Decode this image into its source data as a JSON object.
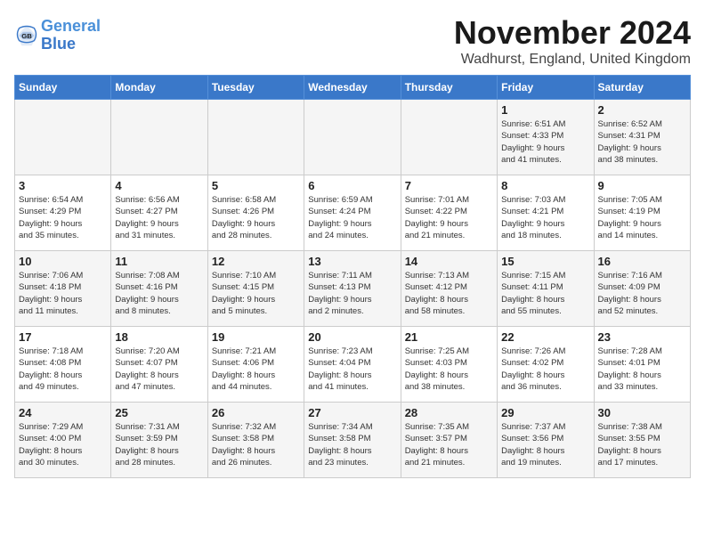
{
  "logo": {
    "text_general": "General",
    "text_blue": "Blue"
  },
  "header": {
    "title": "November 2024",
    "subtitle": "Wadhurst, England, United Kingdom"
  },
  "days_of_week": [
    "Sunday",
    "Monday",
    "Tuesday",
    "Wednesday",
    "Thursday",
    "Friday",
    "Saturday"
  ],
  "weeks": [
    [
      {
        "day": "",
        "info": ""
      },
      {
        "day": "",
        "info": ""
      },
      {
        "day": "",
        "info": ""
      },
      {
        "day": "",
        "info": ""
      },
      {
        "day": "",
        "info": ""
      },
      {
        "day": "1",
        "info": "Sunrise: 6:51 AM\nSunset: 4:33 PM\nDaylight: 9 hours\nand 41 minutes."
      },
      {
        "day": "2",
        "info": "Sunrise: 6:52 AM\nSunset: 4:31 PM\nDaylight: 9 hours\nand 38 minutes."
      }
    ],
    [
      {
        "day": "3",
        "info": "Sunrise: 6:54 AM\nSunset: 4:29 PM\nDaylight: 9 hours\nand 35 minutes."
      },
      {
        "day": "4",
        "info": "Sunrise: 6:56 AM\nSunset: 4:27 PM\nDaylight: 9 hours\nand 31 minutes."
      },
      {
        "day": "5",
        "info": "Sunrise: 6:58 AM\nSunset: 4:26 PM\nDaylight: 9 hours\nand 28 minutes."
      },
      {
        "day": "6",
        "info": "Sunrise: 6:59 AM\nSunset: 4:24 PM\nDaylight: 9 hours\nand 24 minutes."
      },
      {
        "day": "7",
        "info": "Sunrise: 7:01 AM\nSunset: 4:22 PM\nDaylight: 9 hours\nand 21 minutes."
      },
      {
        "day": "8",
        "info": "Sunrise: 7:03 AM\nSunset: 4:21 PM\nDaylight: 9 hours\nand 18 minutes."
      },
      {
        "day": "9",
        "info": "Sunrise: 7:05 AM\nSunset: 4:19 PM\nDaylight: 9 hours\nand 14 minutes."
      }
    ],
    [
      {
        "day": "10",
        "info": "Sunrise: 7:06 AM\nSunset: 4:18 PM\nDaylight: 9 hours\nand 11 minutes."
      },
      {
        "day": "11",
        "info": "Sunrise: 7:08 AM\nSunset: 4:16 PM\nDaylight: 9 hours\nand 8 minutes."
      },
      {
        "day": "12",
        "info": "Sunrise: 7:10 AM\nSunset: 4:15 PM\nDaylight: 9 hours\nand 5 minutes."
      },
      {
        "day": "13",
        "info": "Sunrise: 7:11 AM\nSunset: 4:13 PM\nDaylight: 9 hours\nand 2 minutes."
      },
      {
        "day": "14",
        "info": "Sunrise: 7:13 AM\nSunset: 4:12 PM\nDaylight: 8 hours\nand 58 minutes."
      },
      {
        "day": "15",
        "info": "Sunrise: 7:15 AM\nSunset: 4:11 PM\nDaylight: 8 hours\nand 55 minutes."
      },
      {
        "day": "16",
        "info": "Sunrise: 7:16 AM\nSunset: 4:09 PM\nDaylight: 8 hours\nand 52 minutes."
      }
    ],
    [
      {
        "day": "17",
        "info": "Sunrise: 7:18 AM\nSunset: 4:08 PM\nDaylight: 8 hours\nand 49 minutes."
      },
      {
        "day": "18",
        "info": "Sunrise: 7:20 AM\nSunset: 4:07 PM\nDaylight: 8 hours\nand 47 minutes."
      },
      {
        "day": "19",
        "info": "Sunrise: 7:21 AM\nSunset: 4:06 PM\nDaylight: 8 hours\nand 44 minutes."
      },
      {
        "day": "20",
        "info": "Sunrise: 7:23 AM\nSunset: 4:04 PM\nDaylight: 8 hours\nand 41 minutes."
      },
      {
        "day": "21",
        "info": "Sunrise: 7:25 AM\nSunset: 4:03 PM\nDaylight: 8 hours\nand 38 minutes."
      },
      {
        "day": "22",
        "info": "Sunrise: 7:26 AM\nSunset: 4:02 PM\nDaylight: 8 hours\nand 36 minutes."
      },
      {
        "day": "23",
        "info": "Sunrise: 7:28 AM\nSunset: 4:01 PM\nDaylight: 8 hours\nand 33 minutes."
      }
    ],
    [
      {
        "day": "24",
        "info": "Sunrise: 7:29 AM\nSunset: 4:00 PM\nDaylight: 8 hours\nand 30 minutes."
      },
      {
        "day": "25",
        "info": "Sunrise: 7:31 AM\nSunset: 3:59 PM\nDaylight: 8 hours\nand 28 minutes."
      },
      {
        "day": "26",
        "info": "Sunrise: 7:32 AM\nSunset: 3:58 PM\nDaylight: 8 hours\nand 26 minutes."
      },
      {
        "day": "27",
        "info": "Sunrise: 7:34 AM\nSunset: 3:58 PM\nDaylight: 8 hours\nand 23 minutes."
      },
      {
        "day": "28",
        "info": "Sunrise: 7:35 AM\nSunset: 3:57 PM\nDaylight: 8 hours\nand 21 minutes."
      },
      {
        "day": "29",
        "info": "Sunrise: 7:37 AM\nSunset: 3:56 PM\nDaylight: 8 hours\nand 19 minutes."
      },
      {
        "day": "30",
        "info": "Sunrise: 7:38 AM\nSunset: 3:55 PM\nDaylight: 8 hours\nand 17 minutes."
      }
    ]
  ]
}
